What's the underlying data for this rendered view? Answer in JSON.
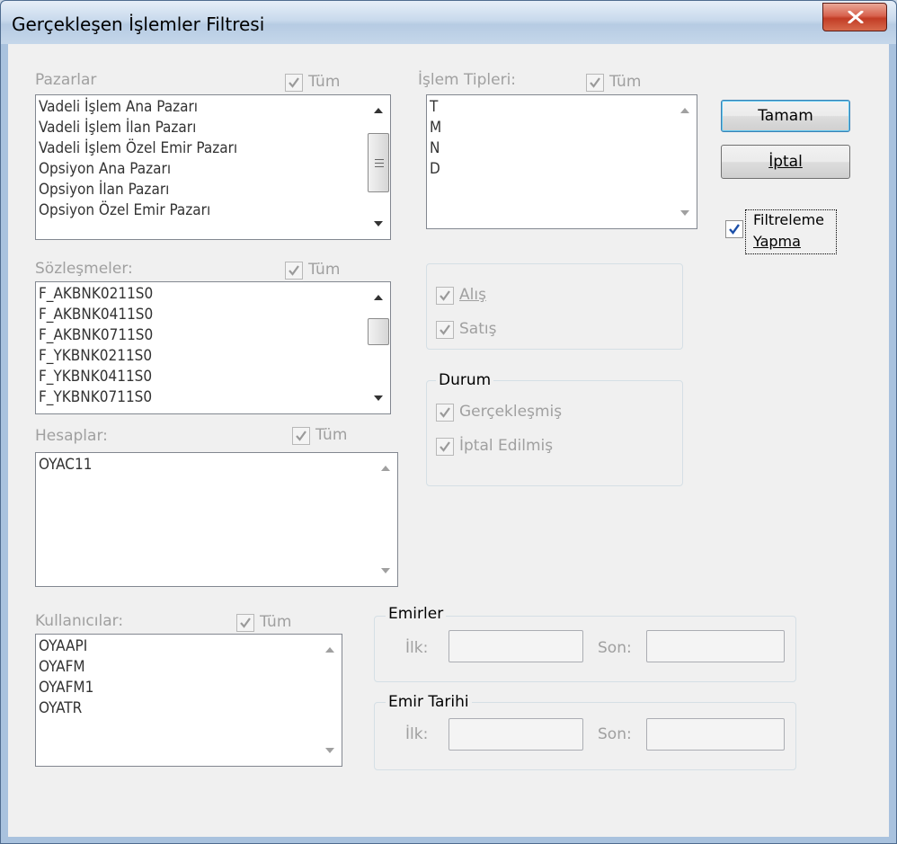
{
  "window": {
    "title": "Gerçekleşen İşlemler Filtresi"
  },
  "markets": {
    "label": "Pazarlar",
    "all_label": "Tüm",
    "items": [
      "Vadeli İşlem Ana Pazarı",
      "Vadeli İşlem İlan Pazarı",
      "Vadeli İşlem Özel Emir Pazarı",
      "Opsiyon Ana Pazarı",
      "Opsiyon İlan Pazarı",
      "Opsiyon Özel Emir Pazarı"
    ]
  },
  "contracts": {
    "label": "Sözleşmeler:",
    "all_label": "Tüm",
    "items": [
      "F_AKBNK0211S0",
      "F_AKBNK0411S0",
      "F_AKBNK0711S0",
      "F_YKBNK0211S0",
      "F_YKBNK0411S0",
      "F_YKBNK0711S0"
    ]
  },
  "accounts": {
    "label": "Hesaplar:",
    "all_label": "Tüm",
    "items": [
      "OYAC11"
    ]
  },
  "users": {
    "label": "Kullanıcılar:",
    "all_label": "Tüm",
    "items": [
      "OYAAPI",
      "OYAFM",
      "OYAFM1",
      "OYATR"
    ]
  },
  "trade_types": {
    "label": "İşlem Tipleri:",
    "all_label": "Tüm",
    "items": [
      "T",
      "M",
      "N",
      "D"
    ]
  },
  "side": {
    "buy_label": "Alış",
    "sell_label": "Satış"
  },
  "status": {
    "title": "Durum",
    "filled_label": "Gerçekleşmiş",
    "cancelled_label": "İptal Edilmiş"
  },
  "orders": {
    "title": "Emirler",
    "first_label": "İlk:",
    "last_label": "Son:",
    "first_value": "",
    "last_value": ""
  },
  "order_date": {
    "title": "Emir Tarihi",
    "first_label": "İlk:",
    "last_label": "Son:",
    "first_value": "",
    "last_value": ""
  },
  "buttons": {
    "ok": "Tamam",
    "cancel": "İptal"
  },
  "no_filter": {
    "label_line1": "Filtreleme",
    "label_line2": "Yapma",
    "checked": true
  },
  "colors": {
    "disabled_text": "#a0a0a0",
    "check_blue": "#1c4fa8",
    "check_gray": "#9a9a9a",
    "close_red": "#c23c25"
  }
}
